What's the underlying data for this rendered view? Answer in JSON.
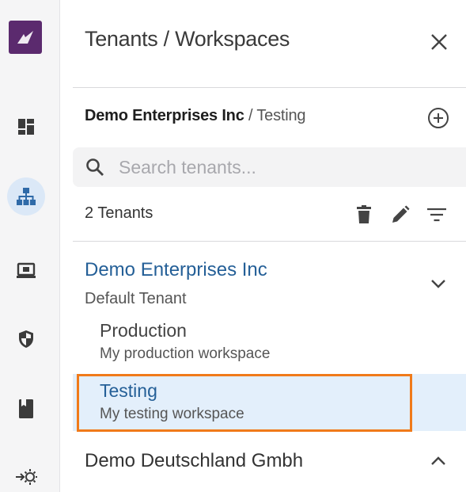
{
  "panel": {
    "title": "Tenants / Workspaces",
    "context_org": "Demo Enterprises Inc",
    "context_separator": " / ",
    "context_workspace": "Testing",
    "search_placeholder": "Search tenants...",
    "tenant_count": "2 Tenants"
  },
  "tenants": [
    {
      "name": "Demo Enterprises Inc",
      "subtitle": "Default Tenant",
      "expanded": true,
      "workspaces": [
        {
          "name": "Production",
          "description": "My production workspace",
          "selected": false
        },
        {
          "name": "Testing",
          "description": "My testing workspace",
          "selected": true
        }
      ]
    },
    {
      "name": "Demo Deutschland Gmbh",
      "expanded": false
    }
  ],
  "rail_icons": [
    "dashboard-icon",
    "sitemap-icon",
    "monitor-icon",
    "shield-icon",
    "book-icon",
    "settings-arrow-icon"
  ],
  "colors": {
    "brand": "#5b2a6e",
    "accent": "#245f97",
    "selected_bg": "#e3effb",
    "highlight": "#f07a1a"
  }
}
